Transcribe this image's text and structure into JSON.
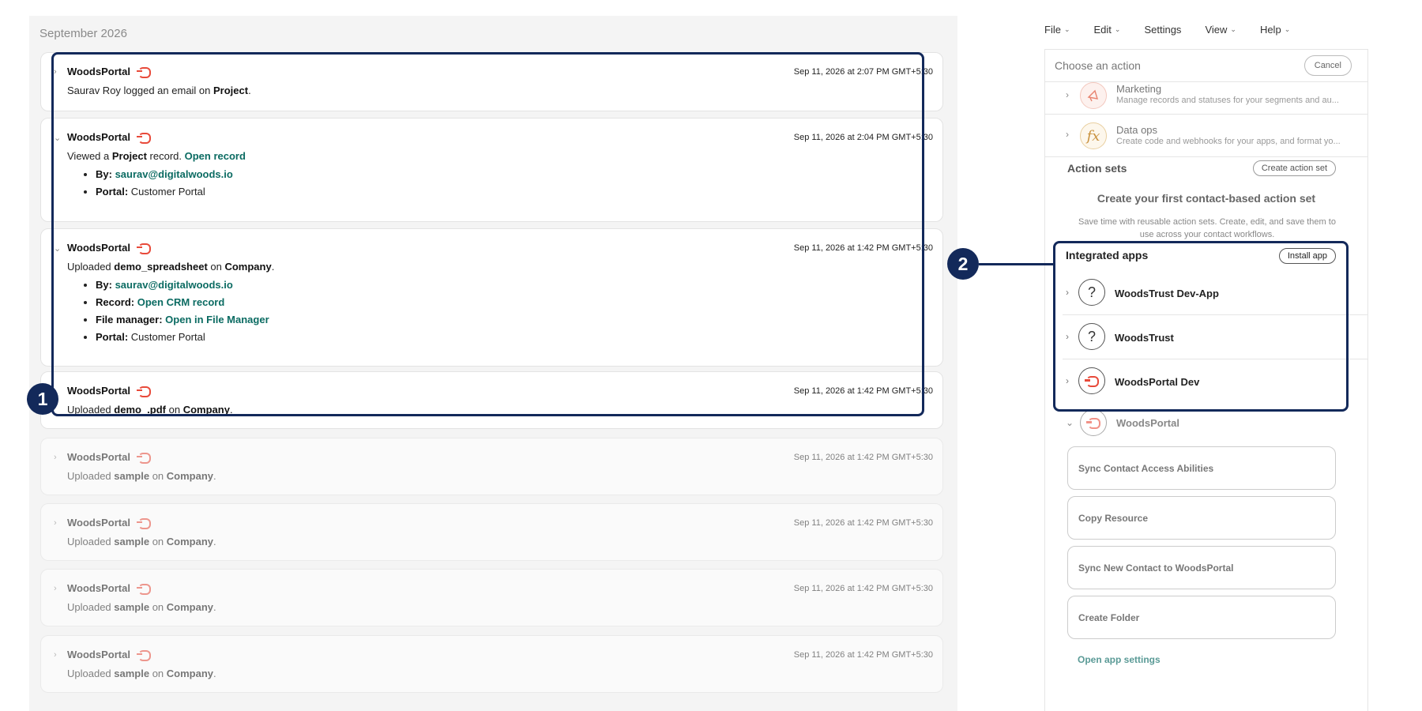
{
  "timeline": {
    "month": "September 2026",
    "cards": [
      {
        "title": "WoodsPortal",
        "time": "Sep 11, 2026 at 2:07 PM GMT+5:30",
        "chevron": "›",
        "line": [
          {
            "t": "Saurav Roy logged an email on "
          },
          {
            "t": "Project",
            "b": true
          },
          {
            "t": "."
          }
        ]
      },
      {
        "title": "WoodsPortal",
        "time": "Sep 11, 2026 at 2:04 PM GMT+5:30",
        "chevron": "⌄",
        "line": [
          {
            "t": "Viewed a "
          },
          {
            "t": "Project",
            "b": true
          },
          {
            "t": " record. "
          },
          {
            "t": "Open record",
            "link": true
          }
        ],
        "bullets": [
          {
            "label": "By:",
            "value": "saurav@digitalwoods.io",
            "link": true
          },
          {
            "label": "Portal:",
            "value": "Customer Portal"
          }
        ]
      },
      {
        "title": "WoodsPortal",
        "time": "Sep 11, 2026 at 1:42 PM GMT+5:30",
        "chevron": "⌄",
        "line": [
          {
            "t": "Uploaded "
          },
          {
            "t": "demo_spreadsheet",
            "b": true
          },
          {
            "t": " on "
          },
          {
            "t": "Company",
            "b": true
          },
          {
            "t": "."
          }
        ],
        "bullets": [
          {
            "label": "By:",
            "value": "saurav@digitalwoods.io",
            "link": true
          },
          {
            "label": "Record:",
            "value": "Open CRM record",
            "link": true
          },
          {
            "label": "File manager:",
            "value": "Open in File Manager",
            "link": true
          },
          {
            "label": "Portal:",
            "value": "Customer Portal"
          }
        ]
      },
      {
        "title": "WoodsPortal",
        "time": "Sep 11, 2026 at 1:42 PM GMT+5:30",
        "chevron": "›",
        "line": [
          {
            "t": "Uploaded "
          },
          {
            "t": "demo_.pdf",
            "b": true
          },
          {
            "t": " on "
          },
          {
            "t": "Company",
            "b": true
          },
          {
            "t": "."
          }
        ]
      },
      {
        "title": "WoodsPortal",
        "time": "Sep 11, 2026 at 1:42 PM GMT+5:30",
        "chevron": "›",
        "faded": true,
        "line": [
          {
            "t": "Uploaded "
          },
          {
            "t": "sample",
            "b": true
          },
          {
            "t": " on "
          },
          {
            "t": "Company",
            "b": true
          },
          {
            "t": "."
          }
        ]
      },
      {
        "title": "WoodsPortal",
        "time": "Sep 11, 2026 at 1:42 PM GMT+5:30",
        "chevron": "›",
        "faded": true,
        "line": [
          {
            "t": "Uploaded "
          },
          {
            "t": "sample",
            "b": true
          },
          {
            "t": " on "
          },
          {
            "t": "Company",
            "b": true
          },
          {
            "t": "."
          }
        ]
      },
      {
        "title": "WoodsPortal",
        "time": "Sep 11, 2026 at 1:42 PM GMT+5:30",
        "chevron": "›",
        "faded": true,
        "line": [
          {
            "t": "Uploaded "
          },
          {
            "t": "sample",
            "b": true
          },
          {
            "t": " on "
          },
          {
            "t": "Company",
            "b": true
          },
          {
            "t": "."
          }
        ]
      },
      {
        "title": "WoodsPortal",
        "time": "Sep 11, 2026 at 1:42 PM GMT+5:30",
        "chevron": "›",
        "faded": true,
        "line": [
          {
            "t": "Uploaded "
          },
          {
            "t": "sample",
            "b": true
          },
          {
            "t": " on "
          },
          {
            "t": "Company",
            "b": true
          },
          {
            "t": "."
          }
        ]
      }
    ]
  },
  "menubar": {
    "file": "File",
    "edit": "Edit",
    "settings": "Settings",
    "view": "View",
    "help": "Help",
    "chevron": "⌄"
  },
  "panel": {
    "choose": "Choose an action",
    "cancel": "Cancel",
    "marketing": {
      "name": "Marketing",
      "desc": "Manage records and statuses for your segments and au..."
    },
    "dataops": {
      "name": "Data ops",
      "desc": "Create code and webhooks for your apps, and format yo...",
      "icon_text": "fx"
    },
    "action_sets": {
      "title": "Action sets",
      "button": "Create action set",
      "empty_title": "Create your first contact-based action set",
      "empty_desc": "Save time with reusable action sets. Create, edit, and save them to use across your contact workflows."
    },
    "integrated": {
      "title": "Integrated apps",
      "button": "Install app",
      "apps": [
        {
          "name": "WoodsTrust Dev-App",
          "icon": "question-icon",
          "glyph": "?"
        },
        {
          "name": "WoodsTrust",
          "icon": "question-icon",
          "glyph": "?"
        },
        {
          "name": "WoodsPortal Dev",
          "icon": "woodsportal-icon",
          "glyph": ""
        }
      ]
    },
    "woodsportal": {
      "name": "WoodsPortal",
      "actions": [
        "Sync Contact Access Abilities",
        "Copy Resource",
        "Sync New Contact to WoodsPortal",
        "Create Folder"
      ],
      "settings_link": "Open app settings"
    }
  },
  "overlay": {
    "badge1": "1",
    "badge2": "2",
    "color": "#13295a"
  },
  "colors": {
    "accent_link": "#0b6b62",
    "portal_red": "#e84a3a"
  }
}
